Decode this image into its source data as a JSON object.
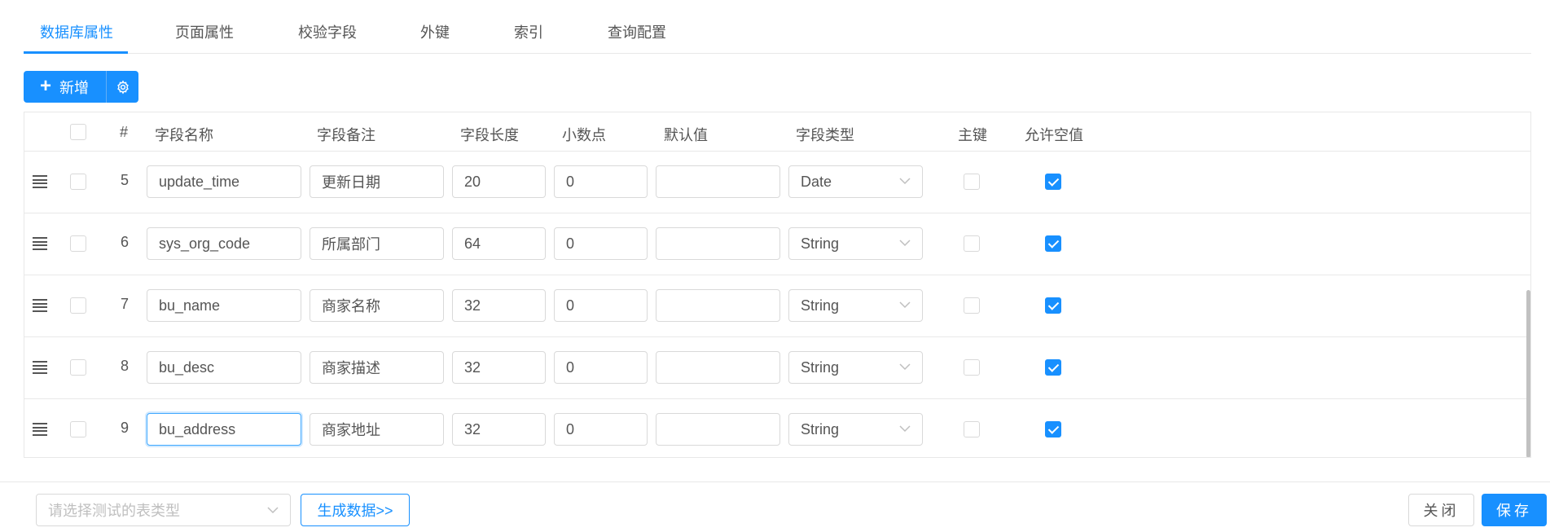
{
  "tabs": [
    {
      "label": "数据库属性",
      "active": true
    },
    {
      "label": "页面属性",
      "active": false
    },
    {
      "label": "校验字段",
      "active": false
    },
    {
      "label": "外键",
      "active": false
    },
    {
      "label": "索引",
      "active": false
    },
    {
      "label": "查询配置",
      "active": false
    }
  ],
  "toolbar": {
    "add_label": "新增",
    "add_icon": "plus-icon",
    "settings_icon": "gear-icon"
  },
  "table": {
    "headers": {
      "index": "#",
      "field_name": "字段名称",
      "field_comment": "字段备注",
      "field_length": "字段长度",
      "decimal": "小数点",
      "default_value": "默认值",
      "field_type": "字段类型",
      "primary_key": "主键",
      "nullable": "允许空值"
    },
    "rows": [
      {
        "index": "5",
        "field_name": "update_time",
        "field_comment": "更新日期",
        "field_length": "20",
        "decimal": "0",
        "default_value": "",
        "field_type": "Date",
        "primary_key": false,
        "nullable": true,
        "selected": false
      },
      {
        "index": "6",
        "field_name": "sys_org_code",
        "field_comment": "所属部门",
        "field_length": "64",
        "decimal": "0",
        "default_value": "",
        "field_type": "String",
        "primary_key": false,
        "nullable": true,
        "selected": false
      },
      {
        "index": "7",
        "field_name": "bu_name",
        "field_comment": "商家名称",
        "field_length": "32",
        "decimal": "0",
        "default_value": "",
        "field_type": "String",
        "primary_key": false,
        "nullable": true,
        "selected": false
      },
      {
        "index": "8",
        "field_name": "bu_desc",
        "field_comment": "商家描述",
        "field_length": "32",
        "decimal": "0",
        "default_value": "",
        "field_type": "String",
        "primary_key": false,
        "nullable": true,
        "selected": false
      },
      {
        "index": "9",
        "field_name": "bu_address",
        "field_comment": "商家地址",
        "field_length": "32",
        "decimal": "0",
        "default_value": "",
        "field_type": "String",
        "primary_key": false,
        "nullable": true,
        "selected": false,
        "focused": true
      }
    ]
  },
  "footer": {
    "table_type_placeholder": "请选择测试的表类型",
    "generate_label": "生成数据>>",
    "close_label": "关闭",
    "save_label": "保存"
  },
  "colors": {
    "accent": "#1890ff",
    "border": "#d9d9d9"
  }
}
